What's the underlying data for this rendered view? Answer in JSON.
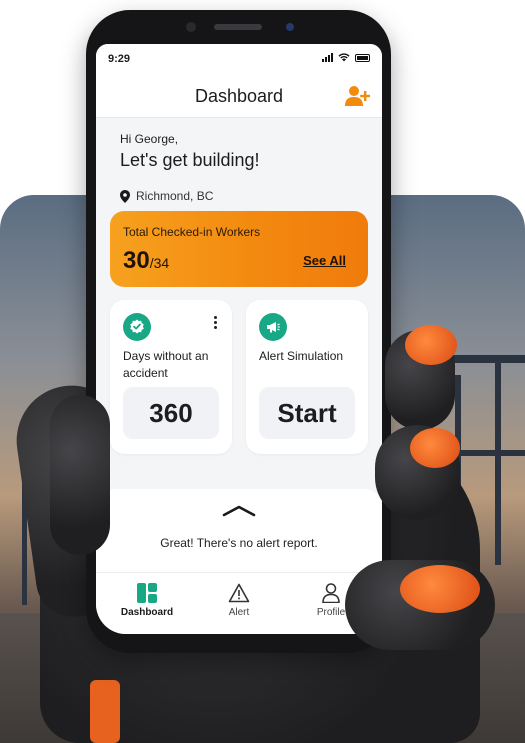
{
  "status_bar": {
    "time": "9:29"
  },
  "header": {
    "title": "Dashboard",
    "add_user_icon": "person-add-icon"
  },
  "greeting": {
    "hello": "Hi George,",
    "headline": "Let's get building!"
  },
  "location": {
    "icon": "location-pin-icon",
    "name": "Richmond, BC"
  },
  "workers_card": {
    "title": "Total Checked-in Workers",
    "checked_in": "30",
    "total": "/34",
    "link": "See All"
  },
  "tiles": [
    {
      "icon": "verified-check-icon",
      "label": "Days without an accident",
      "value": "360"
    },
    {
      "icon": "megaphone-icon",
      "label": "Alert Simulation",
      "value": "Start"
    }
  ],
  "alert_panel": {
    "message": "Great! There's no alert report."
  },
  "nav": [
    {
      "label": "Dashboard",
      "icon": "dashboard-icon",
      "active": true
    },
    {
      "label": "Alert",
      "icon": "warning-icon",
      "active": false
    },
    {
      "label": "Profile",
      "icon": "profile-icon",
      "active": false
    }
  ],
  "colors": {
    "accent_orange": "#F38A10",
    "accent_green": "#18A886"
  }
}
